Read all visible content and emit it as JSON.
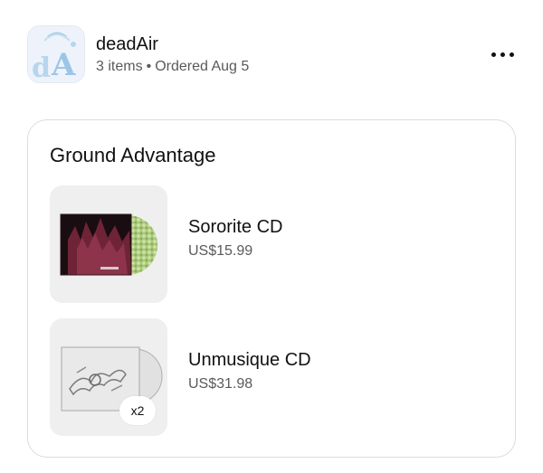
{
  "shop": {
    "name": "deadAir",
    "items_count": "3 items",
    "separator": "•",
    "ordered": "Ordered Aug 5",
    "logo_icon": "deadair-logo-icon"
  },
  "more_icon": "more-horizontal-icon",
  "shipment": {
    "title": "Ground Advantage",
    "items": [
      {
        "name": "Sororite CD",
        "price": "US$15.99",
        "image_icon": "sororite-cd-cover-image"
      },
      {
        "name": "Unmusique CD",
        "price": "US$31.98",
        "quantity": "x2",
        "image_icon": "unmusique-cd-cover-image"
      }
    ]
  },
  "colors": {
    "text_primary": "#111111",
    "text_secondary": "#5a5a5a",
    "thumb_bg": "#efefef",
    "card_border": "#dcdcdc"
  }
}
